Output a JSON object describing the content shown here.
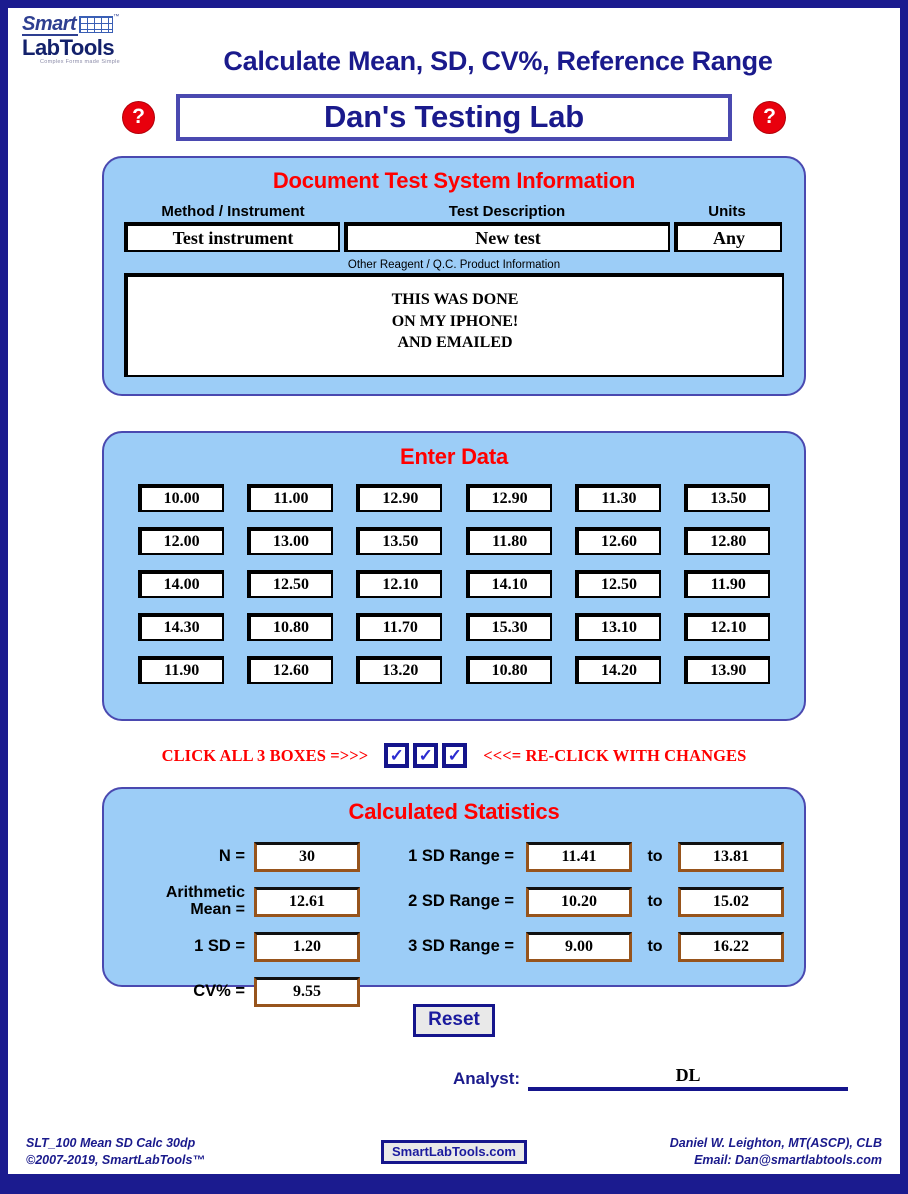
{
  "brand": {
    "logo_line1": "Smart",
    "logo_line2": "LabTools",
    "logo_tm": "™",
    "logo_tagline": "Complex Forms made Simple"
  },
  "header": {
    "app_title": "Calculate Mean, SD, CV%, Reference Range",
    "help_icon_left": "?",
    "help_icon_right": "?",
    "lab_name": "Dan's Testing Lab"
  },
  "doc_panel": {
    "title": "Document Test System Information",
    "label_method": "Method / Instrument",
    "label_description": "Test Description",
    "label_units": "Units",
    "value_method": "Test instrument",
    "value_description": "New test",
    "value_units": "Any",
    "reagent_label": "Other Reagent / Q.C. Product Information",
    "reagent_line1": "THIS WAS DONE",
    "reagent_line2": "ON MY IPHONE!",
    "reagent_line3": "AND EMAILED"
  },
  "data_panel": {
    "title": "Enter Data",
    "values": [
      "10.00",
      "11.00",
      "12.90",
      "12.90",
      "11.30",
      "13.50",
      "12.00",
      "13.00",
      "13.50",
      "11.80",
      "12.60",
      "12.80",
      "14.00",
      "12.50",
      "12.10",
      "14.10",
      "12.50",
      "11.90",
      "14.30",
      "10.80",
      "11.70",
      "15.30",
      "13.10",
      "12.10",
      "11.90",
      "12.60",
      "13.20",
      "10.80",
      "14.20",
      "13.90"
    ]
  },
  "check_row": {
    "left_text": "CLICK ALL 3 BOXES =>>>",
    "right_text": "<<<= RE-CLICK WITH CHANGES",
    "check_mark": "✓",
    "box_count": 3
  },
  "stats_panel": {
    "title": "Calculated Statistics",
    "label_n": "N =",
    "value_n": "30",
    "label_mean_l1": "Arithmetic",
    "label_mean_l2": "Mean =",
    "value_mean": "12.61",
    "label_sd": "1 SD =",
    "value_sd": "1.20",
    "label_cv": "CV% =",
    "value_cv": "9.55",
    "label_1sd_range": "1 SD Range =",
    "value_1sd_low": "11.41",
    "value_1sd_high": "13.81",
    "label_2sd_range": "2 SD Range =",
    "value_2sd_low": "10.20",
    "value_2sd_high": "15.02",
    "label_3sd_range": "3 SD Range =",
    "value_3sd_low": "9.00",
    "value_3sd_high": "16.22",
    "to_word": "to"
  },
  "actions": {
    "reset_label": "Reset",
    "analyst_label": "Analyst:",
    "analyst_value": "DL"
  },
  "footer": {
    "left_line1": "SLT_100 Mean SD Calc 30dp",
    "left_line2": "©2007-2019, SmartLabTools™",
    "center_button": "SmartLabTools.com",
    "right_line1": "Daniel W. Leighton, MT(ASCP), CLB",
    "right_line2": "Email: Dan@smartlabtools.com"
  },
  "colors": {
    "page_border": "#1b1b8f",
    "panel_blue": "#9ccdf7",
    "panel_border": "#4a49b0",
    "panel_title_red": "#ff0000",
    "navy_text": "#1a1a8c",
    "help_red": "#e8000d",
    "stat_box_border": "#97541c"
  }
}
